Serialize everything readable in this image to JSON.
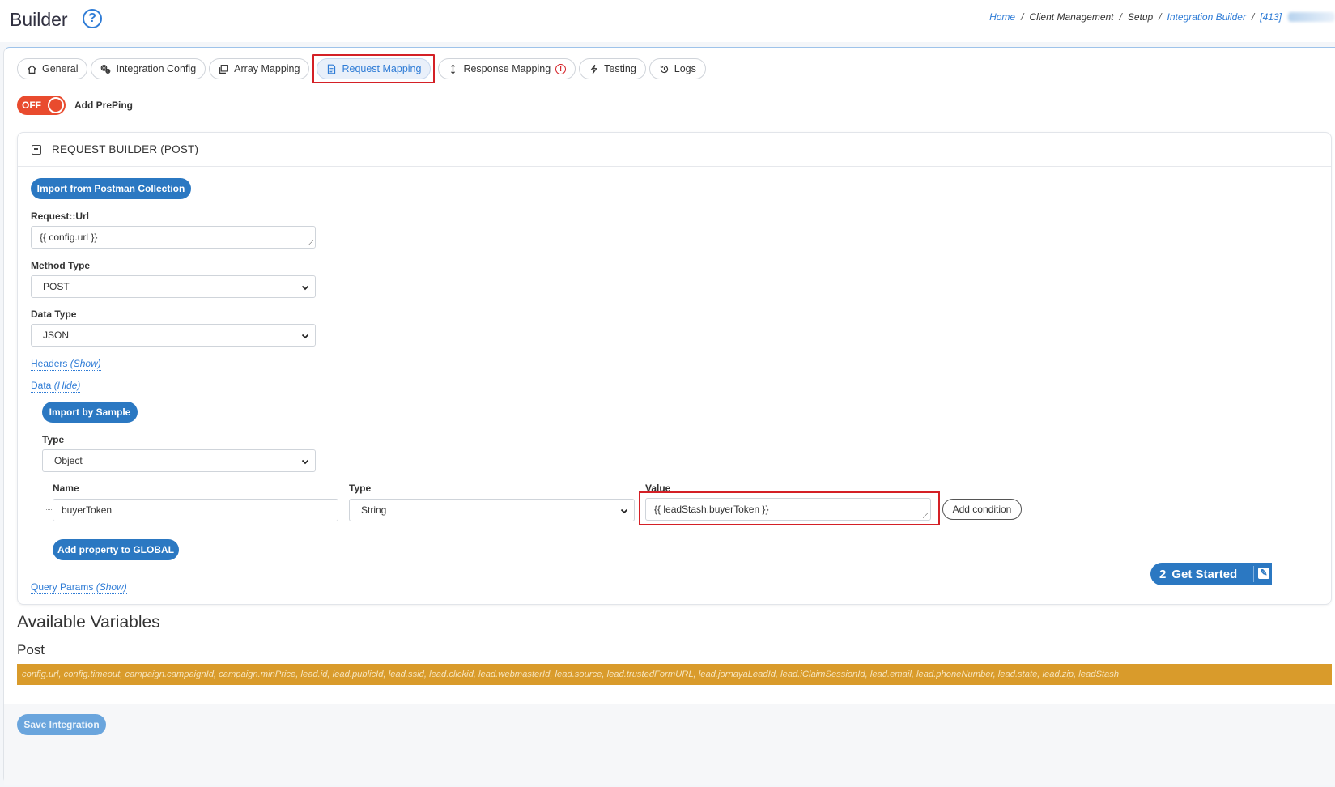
{
  "header": {
    "title": "Builder",
    "help_glyph": "?",
    "breadcrumb": [
      "Home",
      "Client Management",
      "Setup",
      "Integration Builder",
      "[413]"
    ],
    "breadcrumb_separator": "/"
  },
  "tabs": [
    {
      "label": "General",
      "icon": "home-icon"
    },
    {
      "label": "Integration Config",
      "icon": "gears-icon"
    },
    {
      "label": "Array Mapping",
      "icon": "copy-icon"
    },
    {
      "label": "Request Mapping",
      "icon": "document-icon",
      "active": true
    },
    {
      "label": "Response Mapping",
      "icon": "arrows-vertical-icon",
      "warning": "!"
    },
    {
      "label": "Testing",
      "icon": "bolt-icon"
    },
    {
      "label": "Logs",
      "icon": "history-icon"
    }
  ],
  "preping": {
    "toggle_state": "OFF",
    "label": "Add PrePing"
  },
  "request_builder": {
    "title": "REQUEST BUILDER (POST)",
    "import_postman_label": "Import from Postman Collection",
    "url_label": "Request::Url",
    "url_value": "{{ config.url }}",
    "method_label": "Method Type",
    "method_value": "POST",
    "data_type_label": "Data Type",
    "data_type_value": "JSON",
    "headers_link": "Headers",
    "headers_toggle": "(Show)",
    "data_link": "Data",
    "data_toggle": "(Hide)",
    "import_sample_label": "Import by Sample",
    "type_label": "Type",
    "type_value": "Object",
    "property": {
      "name_label": "Name",
      "name_value": "buyerToken",
      "type_label": "Type",
      "type_value": "String",
      "value_label": "Value",
      "value_value": "{{ leadStash.buyerToken }}",
      "add_condition_label": "Add condition"
    },
    "add_property_label": "Add property to GLOBAL",
    "query_params_link": "Query Params",
    "query_params_toggle": "(Show)"
  },
  "get_started": {
    "count": "2",
    "label": "Get Started"
  },
  "available_variables": {
    "title": "Available Variables",
    "section": "Post",
    "list": "config.url, config.timeout, campaign.campaignId, campaign.minPrice, lead.id, lead.publicId, lead.ssid, lead.clickid, lead.webmasterId, lead.source, lead.trustedFormURL, lead.jornayaLeadId, lead.iClaimSessionId, lead.email, lead.phoneNumber, lead.state, lead.zip, leadStash"
  },
  "save_label": "Save Integration",
  "colors": {
    "accent": "#2b78c2",
    "highlight": "#d42026",
    "toggle_off": "#e94b2e",
    "variables_bar": "#d99b2b"
  }
}
